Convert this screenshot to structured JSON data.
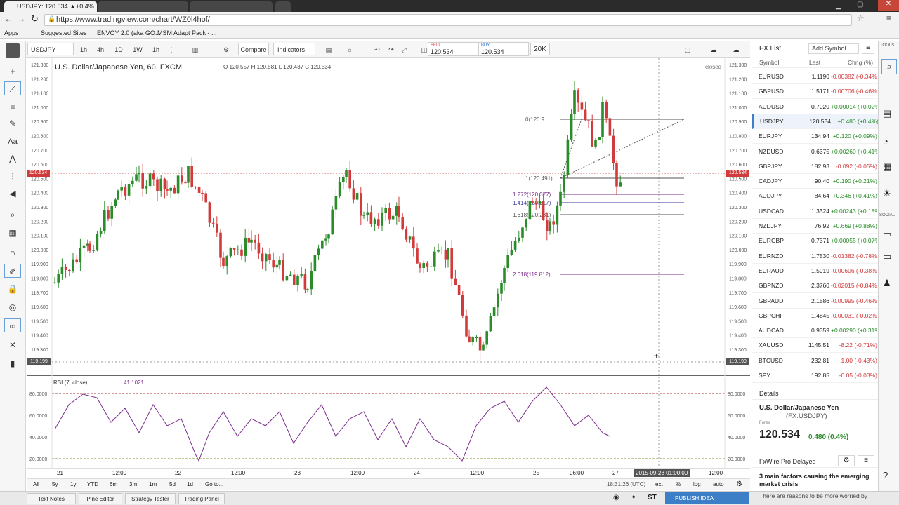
{
  "browser": {
    "tabs": [
      {
        "label": "USDJPY: 120.534 ▲+0.4%",
        "active": true
      },
      {
        "label": "",
        "active": false
      },
      {
        "label": "",
        "active": false
      }
    ],
    "url": "https://www.tradingview.com/chart/WZ0l4hof/",
    "bookmarks": [
      "Apps",
      "Suggested Sites",
      "ENVOY 2.0 (aka GO...",
      "MSM Adapt Pack - ..."
    ]
  },
  "toolbar": {
    "symbol": "USDJPY",
    "intervals": [
      "1h",
      "4h",
      "1D",
      "1W",
      "1h"
    ],
    "compare": "Compare",
    "indicators": "Indicators",
    "sell_label": "SELL",
    "sell_price": "120.534",
    "buy_label": "BUY",
    "buy_price": "120.534",
    "quantity": "20K"
  },
  "chart": {
    "title": "U.S. Dollar/Japanese Yen, 60, FXCM",
    "ohlc": "O 120.557  H 120.581  L 120.437  C 120.534",
    "status": "closed",
    "current_price": "120.534",
    "crosshair_price": "119.199",
    "price_ticks": [
      "121.300",
      "121.200",
      "121.100",
      "121.000",
      "120.900",
      "120.800",
      "120.700",
      "120.600",
      "120.500",
      "120.400",
      "120.300",
      "120.200",
      "120.100",
      "120.000",
      "119.900",
      "119.800",
      "119.700",
      "119.600",
      "119.500",
      "119.400",
      "119.300"
    ],
    "fib_labels": [
      {
        "text": "0(120.9",
        "color": "#555555"
      },
      {
        "text": "1(120.491)",
        "color": "#555555"
      },
      {
        "text": "1.272(120.377)",
        "color": "#7a2a8a"
      },
      {
        "text": "1.414(120.317)",
        "color": "#3a3a9a"
      },
      {
        "text": "1.618(120.231)",
        "color": "#555555"
      },
      {
        "text": "2.618(119.812)",
        "color": "#7a2a8a"
      }
    ]
  },
  "rsi": {
    "label": "RSI (7, close)",
    "value": "41.1021",
    "ticks": [
      "80.0000",
      "60.0000",
      "40.0000",
      "20.0000"
    ]
  },
  "time_axis": {
    "labels": [
      "21",
      "12:00",
      "22",
      "12:00",
      "23",
      "12:00",
      "24",
      "12:00",
      "25",
      "06:00",
      "27",
      "12:00"
    ],
    "crosshair_time": "2015-09-28 01:00:00"
  },
  "ranges": {
    "buttons": [
      "All",
      "5y",
      "1y",
      "YTD",
      "6m",
      "3m",
      "1m",
      "5d",
      "1d",
      "Go to..."
    ],
    "clock": "18:31:26 (UTC)",
    "right_buttons": [
      "ext",
      "%",
      "log",
      "auto"
    ]
  },
  "bottom_panel": {
    "tabs": [
      "Text Notes",
      "Pine Editor",
      "Strategy Tester",
      "Trading Panel"
    ],
    "publish": "PUBLISH IDEA"
  },
  "fx_list": {
    "title": "FX List",
    "add_symbol": "Add Symbol",
    "headers": [
      "Symbol",
      "Last",
      "Chng (%)"
    ],
    "rows": [
      {
        "symbol": "EURUSD",
        "last": "1.1190",
        "change": "-0.00382 (-0.34%)",
        "dir": "neg"
      },
      {
        "symbol": "GBPUSD",
        "last": "1.5171",
        "change": "-0.00706 (-0.46%)",
        "dir": "neg"
      },
      {
        "symbol": "AUDUSD",
        "last": "0.7020",
        "change": "+0.00014 (+0.02%)",
        "dir": "pos"
      },
      {
        "symbol": "USDJPY",
        "last": "120.534",
        "change": "+0.480 (+0.4%)",
        "dir": "pos"
      },
      {
        "symbol": "EURJPY",
        "last": "134.94",
        "change": "+0.120 (+0.09%)",
        "dir": "pos"
      },
      {
        "symbol": "NZDUSD",
        "last": "0.6375",
        "change": "+0.00260 (+0.41%)",
        "dir": "pos"
      },
      {
        "symbol": "GBPJPY",
        "last": "182.93",
        "change": "-0.092 (-0.05%)",
        "dir": "neg"
      },
      {
        "symbol": "CADJPY",
        "last": "90.40",
        "change": "+0.190 (+0.21%)",
        "dir": "pos"
      },
      {
        "symbol": "AUDJPY",
        "last": "84.64",
        "change": "+0.346 (+0.41%)",
        "dir": "pos"
      },
      {
        "symbol": "USDCAD",
        "last": "1.3324",
        "change": "+0.00243 (+0.18%)",
        "dir": "pos"
      },
      {
        "symbol": "NZDJPY",
        "last": "76.92",
        "change": "+0.669 (+0.88%)",
        "dir": "pos"
      },
      {
        "symbol": "EURGBP",
        "last": "0.7371",
        "change": "+0.00055 (+0.07%)",
        "dir": "pos"
      },
      {
        "symbol": "EURNZD",
        "last": "1.7530",
        "change": "-0.01382 (-0.78%)",
        "dir": "neg"
      },
      {
        "symbol": "EURAUD",
        "last": "1.5919",
        "change": "-0.00606 (-0.38%)",
        "dir": "neg"
      },
      {
        "symbol": "GBPNZD",
        "last": "2.3760",
        "change": "-0.02015 (-0.84%)",
        "dir": "neg"
      },
      {
        "symbol": "GBPAUD",
        "last": "2.1586",
        "change": "-0.00995 (-0.46%)",
        "dir": "neg"
      },
      {
        "symbol": "GBPCHF",
        "last": "1.4845",
        "change": "-0.00031 (-0.02%)",
        "dir": "neg"
      },
      {
        "symbol": "AUDCAD",
        "last": "0.9359",
        "change": "+0.00290 (+0.31%)",
        "dir": "pos"
      },
      {
        "symbol": "XAUUSD",
        "last": "1145.51",
        "change": "-8.22 (-0.71%)",
        "dir": "neg"
      },
      {
        "symbol": "BTCUSD",
        "last": "232.81",
        "change": "-1.00 (-0.43%)",
        "dir": "neg"
      },
      {
        "symbol": "SPY",
        "last": "192.85",
        "change": "-0.05 (-0.03%)",
        "dir": "neg"
      }
    ]
  },
  "details": {
    "title": "Details",
    "name": "U.S. Dollar/Japanese Yen",
    "code": "(FX:USDJPY)",
    "type": "Forex",
    "price": "120.534",
    "change": "0.480 (0.4%)"
  },
  "news": {
    "source": "FxWire Pro Delayed",
    "headline": "3 main factors causing the emerging market crisis",
    "snippet": "There are reasons to be more worried by the current EM crisis than when ever"
  },
  "right_icons": {
    "tools": "TOOLS",
    "social": "SOCIAL"
  },
  "colors": {
    "up": "#2a8c2a",
    "down": "#d23b3b",
    "price_badge": "#d23b3b",
    "fib_purple": "#7a2a8a",
    "rsi_line": "#7b2d8e"
  }
}
